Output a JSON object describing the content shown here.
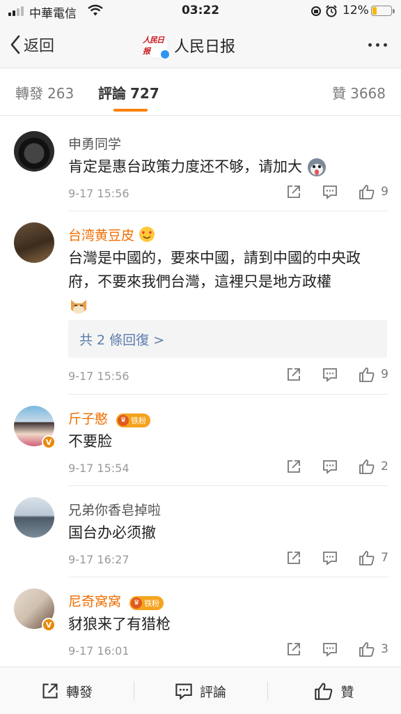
{
  "status_bar": {
    "carrier": "中華電信",
    "time": "03:22",
    "battery_pct": "12%",
    "battery_level": 0.12
  },
  "nav": {
    "back_label": "返回",
    "account_name": "人民日报",
    "logo_text": "人民日报"
  },
  "tabs": {
    "repost": {
      "label": "轉發",
      "count": "263"
    },
    "comment": {
      "label": "評論",
      "count": "727"
    },
    "like": {
      "label": "贊",
      "count": "3668"
    }
  },
  "comments": [
    {
      "username": "申勇同学",
      "text": "肯定是惠台政策力度还不够，请加大",
      "time": "9-17 15:56",
      "likes": "9"
    },
    {
      "username": "台湾黄豆皮",
      "text": "台灣是中國的，要來中國，請到中國的中央政府，不要來我們台灣，這裡只是地方政權",
      "time": "9-17 15:56",
      "likes": "9",
      "replies_label": "共 2 條回復 >"
    },
    {
      "username": "斤子憨",
      "fan_badge": "铁粉",
      "text": "不要脸",
      "time": "9-17 15:54",
      "likes": "2"
    },
    {
      "username": "兄弟你香皂掉啦",
      "text": "国台办必须撤",
      "time": "9-17 16:27",
      "likes": "7"
    },
    {
      "username": "尼奇窝窝",
      "fan_badge": "铁粉",
      "text": "豺狼来了有猎枪",
      "time": "9-17 16:01",
      "likes": "3"
    }
  ],
  "bottom_bar": {
    "repost_label": "轉發",
    "comment_label": "評論",
    "like_label": "贊"
  },
  "colors": {
    "accent": "#ff8200",
    "vip_name": "#f06e00",
    "link": "#5a7cae"
  }
}
